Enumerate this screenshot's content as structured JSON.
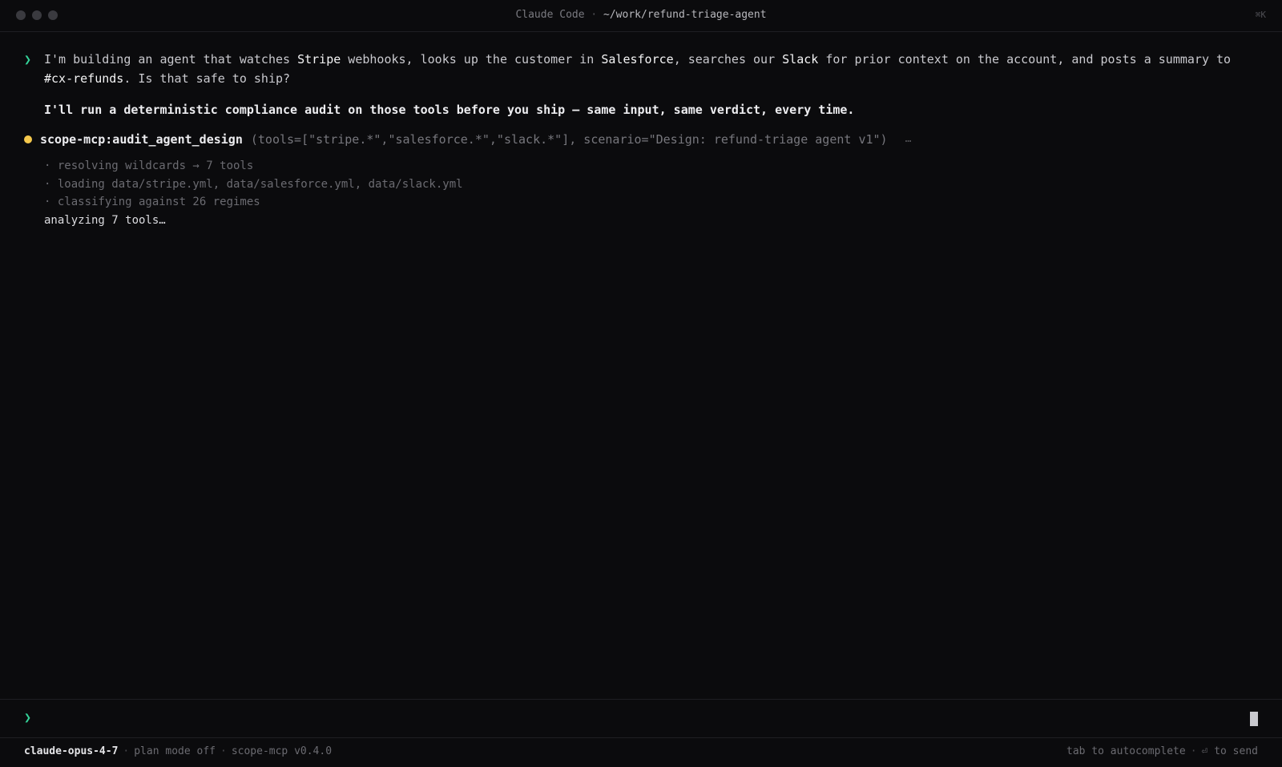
{
  "window": {
    "title_app": "Claude Code",
    "title_sep": "·",
    "title_path": "~/work/refund-triage-agent",
    "shortcut": "⌘K"
  },
  "conversation": {
    "user_prompt_glyph": "❯",
    "user_message": {
      "parts": [
        "I'm building an agent that watches ",
        "Stripe",
        " webhooks, looks up the customer in ",
        "Salesforce",
        ", searches our ",
        "Slack",
        " for prior context on the account, and posts a summary to ",
        "#cx-refunds",
        ". Is that safe to ship?"
      ]
    },
    "assistant_message": "I'll run a deterministic compliance audit on those tools before you ship — same input, same verdict, every time.",
    "tool_call": {
      "name": "scope-mcp:audit_agent_design",
      "args": "(tools=[\"stripe.*\",\"salesforce.*\",\"slack.*\"], scenario=\"Design: refund-triage agent v1\")",
      "ellipsis": "…",
      "status_color": "#f5c84c"
    },
    "steps": [
      "· resolving wildcards → 7 tools",
      "· loading data/stripe.yml, data/salesforce.yml, data/slack.yml",
      "· classifying against 26 regimes"
    ],
    "current_status": "analyzing 7 tools…"
  },
  "input": {
    "prompt_glyph": "❯",
    "value": "",
    "placeholder": ""
  },
  "statusbar": {
    "model": "claude-opus-4-7",
    "sep": "·",
    "plan_mode": "plan mode off",
    "plugin": "scope-mcp v0.4.0",
    "hint_autocomplete": "tab to autocomplete",
    "hint_send": "⏎ to send"
  },
  "colors": {
    "accent_prompt": "#34d399",
    "status_running": "#f5c84c",
    "background": "#0b0b0d"
  }
}
